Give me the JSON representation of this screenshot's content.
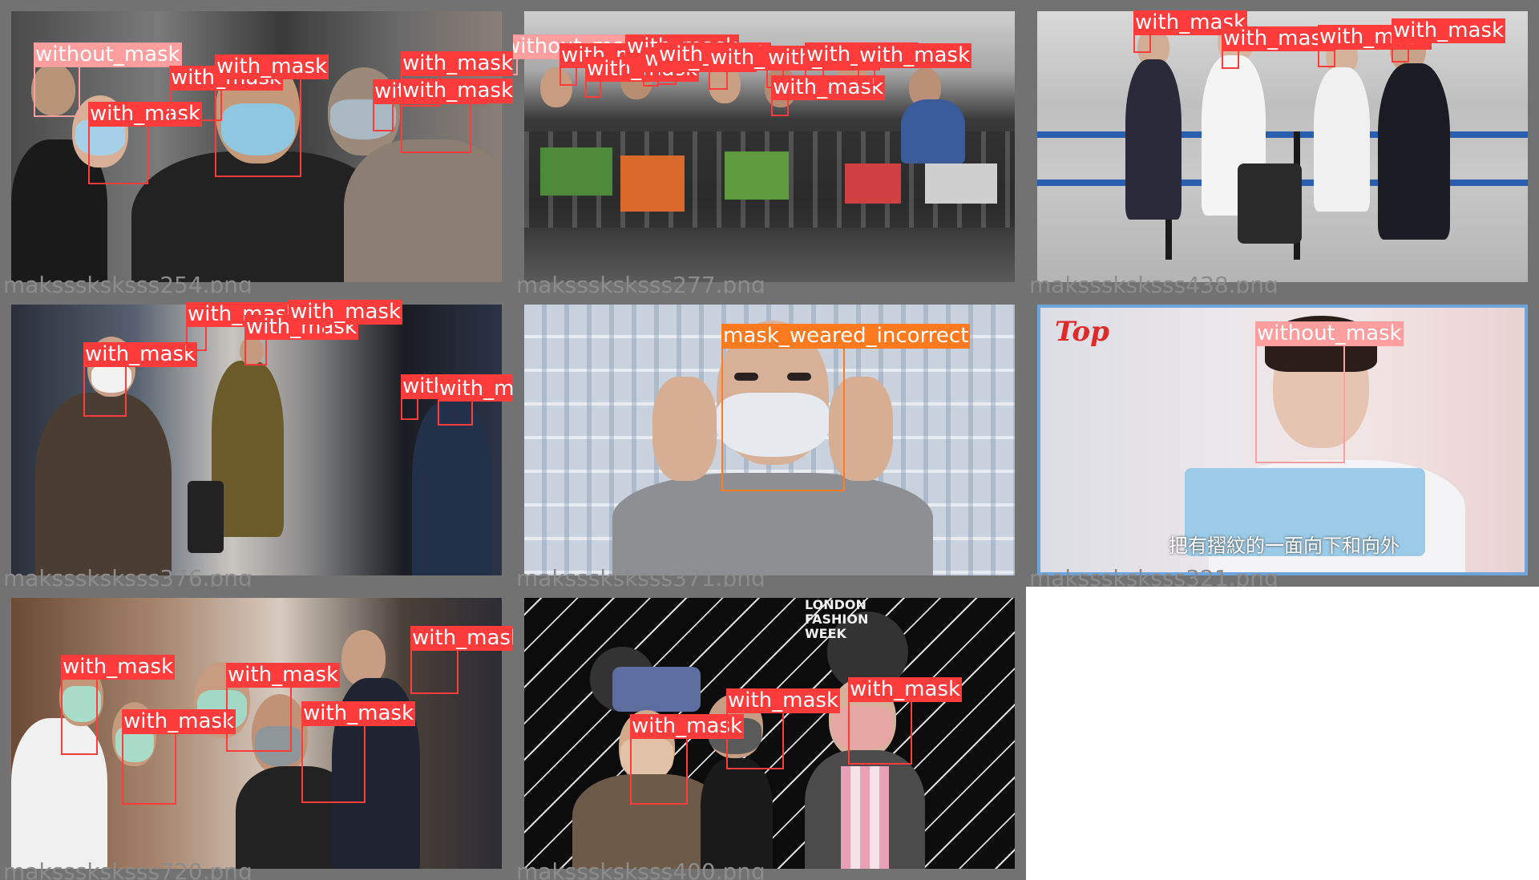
{
  "tiles": [
    {
      "filename": "maksssksksss254.png",
      "detections": [
        {
          "label": "without_mask",
          "class": "without_mask"
        },
        {
          "label": "with_mask",
          "class": "with_mask"
        },
        {
          "label": "with_mask",
          "class": "with_mask"
        },
        {
          "label": "with_mask",
          "class": "with_mask"
        },
        {
          "label": "with_mask",
          "class": "with_mask"
        },
        {
          "label": "with_mask",
          "class": "with_mask"
        },
        {
          "label": "with_mask",
          "class": "with_mask"
        }
      ]
    },
    {
      "filename": "maksssksksss277.png",
      "detections": [
        {
          "label": "without_mask",
          "class": "without_mask"
        },
        {
          "label": "with_mask",
          "class": "with_mask"
        },
        {
          "label": "with_mask",
          "class": "with_mask"
        },
        {
          "label": "with_mask",
          "class": "with_mask"
        },
        {
          "label": "with_mask",
          "class": "with_mask"
        },
        {
          "label": "with_mask",
          "class": "with_mask"
        },
        {
          "label": "with_mask",
          "class": "with_mask"
        },
        {
          "label": "with_mask",
          "class": "with_mask"
        },
        {
          "label": "with_mask",
          "class": "with_mask"
        },
        {
          "label": "with_mask",
          "class": "with_mask"
        },
        {
          "label": "with_mask",
          "class": "with_mask"
        }
      ]
    },
    {
      "filename": "maksssksksss438.png",
      "detections": [
        {
          "label": "with_mask",
          "class": "with_mask"
        },
        {
          "label": "with_mask",
          "class": "with_mask"
        },
        {
          "label": "with_mask",
          "class": "with_mask"
        },
        {
          "label": "with_mask",
          "class": "with_mask"
        }
      ]
    },
    {
      "filename": "maksssksksss376.png",
      "detections": [
        {
          "label": "with_mask",
          "class": "with_mask"
        },
        {
          "label": "with_mask",
          "class": "with_mask"
        },
        {
          "label": "with_mask",
          "class": "with_mask"
        },
        {
          "label": "with_mask",
          "class": "with_mask"
        },
        {
          "label": "with_mask",
          "class": "with_mask"
        },
        {
          "label": "with_mask",
          "class": "with_mask"
        }
      ]
    },
    {
      "filename": "maksssksksss371.png",
      "detections": [
        {
          "label": "mask_weared_incorrect",
          "class": "mask_weared_incorrect"
        }
      ]
    },
    {
      "filename": "maksssksksss321.png",
      "logo_text": "Top",
      "subtitle": "把有摺紋的一面向下和向外",
      "detections": [
        {
          "label": "without_mask",
          "class": "without_mask"
        }
      ]
    },
    {
      "filename": "maksssksksss720.png",
      "detections": [
        {
          "label": "with_mask",
          "class": "with_mask"
        },
        {
          "label": "with_mask",
          "class": "with_mask"
        },
        {
          "label": "with_mask",
          "class": "with_mask"
        },
        {
          "label": "with_mask",
          "class": "with_mask"
        },
        {
          "label": "with_mask",
          "class": "with_mask"
        }
      ]
    },
    {
      "filename": "maksssksksss400.png",
      "poster_text": [
        "LONDON",
        "FASHION",
        "WEEK"
      ],
      "detections": [
        {
          "label": "with_mask",
          "class": "with_mask"
        },
        {
          "label": "with_mask",
          "class": "with_mask"
        },
        {
          "label": "with_mask",
          "class": "with_mask"
        },
        {
          "label": "with_mask",
          "class": "with_mask"
        }
      ]
    }
  ],
  "colors": {
    "with_mask": "#ff3b3b",
    "without_mask": "#ff9e9e",
    "mask_weared_incorrect": "#ff7a1e",
    "tile_border": "#727272",
    "filename_text": "#8c8c8c"
  }
}
